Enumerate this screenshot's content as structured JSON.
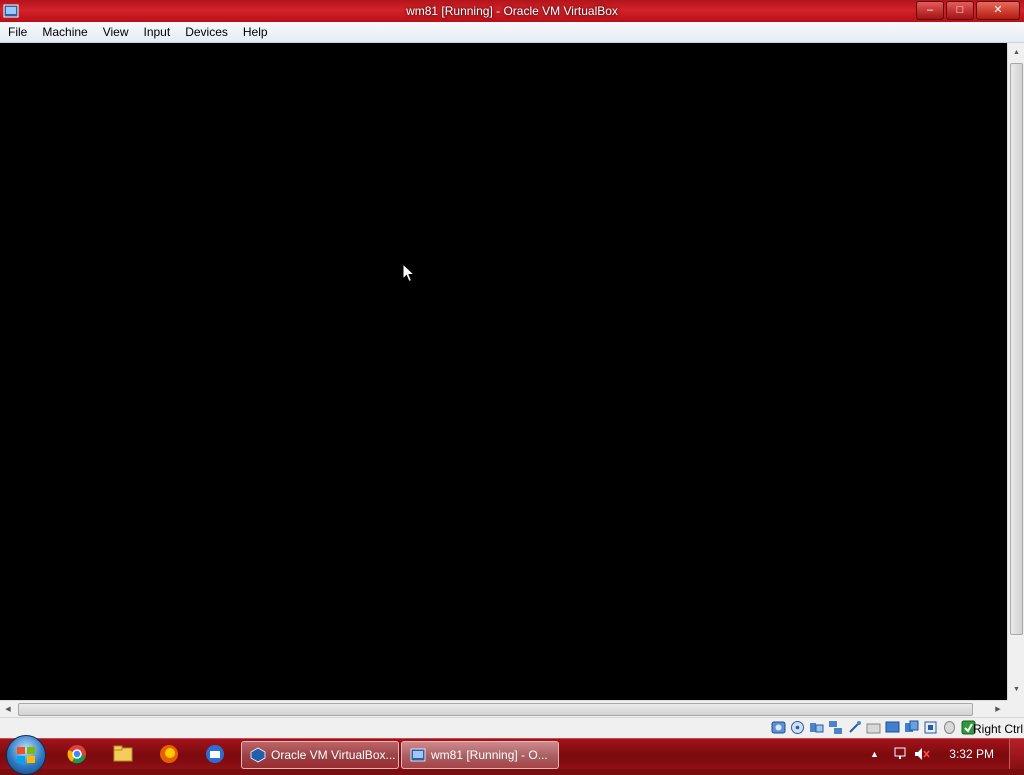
{
  "window": {
    "title": "wm81 [Running] - Oracle VM VirtualBox",
    "controls": {
      "minimize": "–",
      "maximize": "□",
      "close": "✕"
    }
  },
  "menu": {
    "items": [
      "File",
      "Machine",
      "View",
      "Input",
      "Devices",
      "Help"
    ]
  },
  "statusbar": {
    "icons": [
      "hard-disk-icon",
      "optical-drive-icon",
      "audio-icon",
      "network-icon",
      "usb-icon",
      "shared-folders-icon",
      "display-icon",
      "video-capture-icon",
      "virtualization-icon",
      "mouse-integration-icon",
      "keyboard-capture-icon"
    ],
    "host_key": "Right Ctrl"
  },
  "taskbar": {
    "pinned": [
      "chrome-icon",
      "file-explorer-icon",
      "firefox-icon",
      "thunderbird-icon"
    ],
    "tasks": [
      {
        "label": "Oracle VM VirtualBox...",
        "icon": "virtualbox-icon"
      },
      {
        "label": "wm81 [Running] - O...",
        "icon": "virtualbox-vm-icon"
      }
    ],
    "clock": "3:32 PM"
  },
  "colors": {
    "titlebar": "#c81a22",
    "vm_screen": "#000000",
    "taskbar": "#8f1015"
  }
}
